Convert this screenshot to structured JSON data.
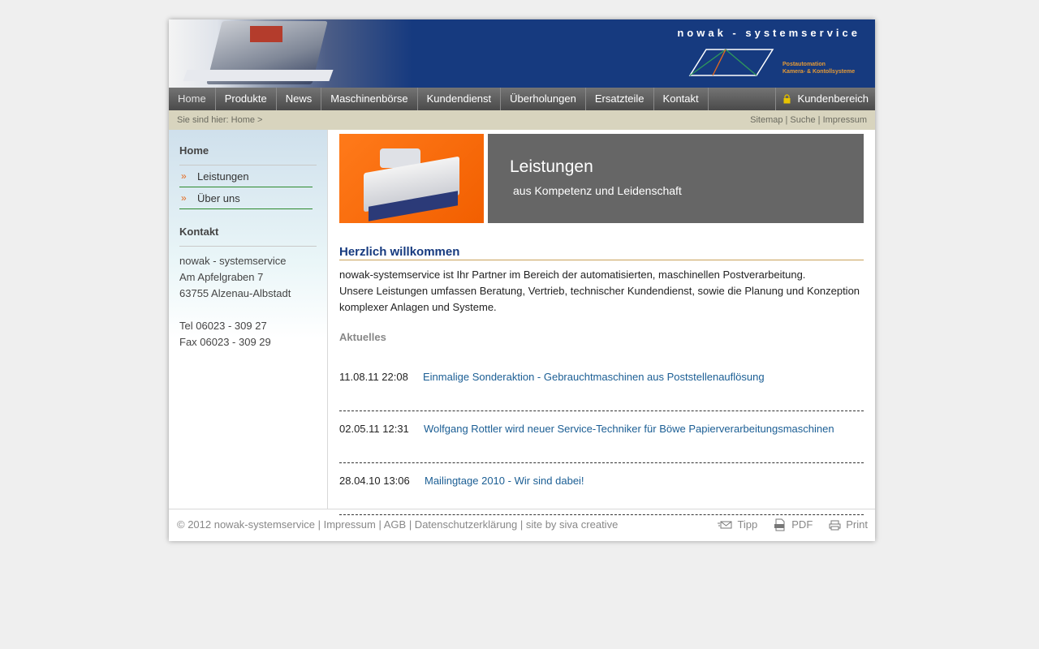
{
  "header": {
    "brand": "nowak - systemservice",
    "tagline_1": "Postautomation",
    "tagline_2": "Kamera- & Kontollsysteme"
  },
  "nav": {
    "items": [
      "Home",
      "Produkte",
      "News",
      "Maschinenbörse",
      "Kundendienst",
      "Überholungen",
      "Ersatzteile",
      "Kontakt"
    ],
    "active": "Home",
    "login_label": "Kundenbereich"
  },
  "breadcrumb": {
    "text": "Sie sind hier: Home >",
    "links": "Sitemap | Suche | Impressum"
  },
  "sidebar": {
    "section1_title": "Home",
    "items": [
      "Leistungen",
      "Über uns"
    ],
    "section2_title": "Kontakt",
    "address": {
      "company": "nowak - systemservice",
      "street": "Am Apfelgraben 7",
      "city": "63755 Alzenau-Albstadt",
      "tel": "Tel  06023 - 309 27",
      "fax": "Fax 06023 - 309 29"
    }
  },
  "banner": {
    "title": "Leistungen",
    "subtitle": "aus Kompetenz und Leidenschaft"
  },
  "main": {
    "heading": "Herzlich willkommen",
    "intro_1": "nowak-systemservice ist Ihr Partner im Bereich der automatisierten, maschinellen Postverarbeitung.",
    "intro_2": "Unsere Leistungen umfassen Beratung, Vertrieb, technischer Kundendienst, sowie die Planung und Konzeption komplexer Anlagen und Systeme.",
    "news_title": "Aktuelles",
    "news": [
      {
        "date": "11.08.11 22:08",
        "title": "Einmalige Sonderaktion - Gebrauchtmaschinen aus Poststellenauflösung"
      },
      {
        "date": "02.05.11 12:31",
        "title": "Wolfgang Rottler wird neuer Service-Techniker für Böwe Papierverarbeitungsmaschinen"
      },
      {
        "date": "28.04.10 13:06",
        "title": "Mailingtage 2010 - Wir sind dabei!"
      }
    ]
  },
  "footer": {
    "copyright": "© 2012 nowak-systemservice | Impressum | AGB | Datenschutzerklärung | site by siva creative",
    "tipp": "Tipp",
    "pdf": "PDF",
    "print": "Print"
  },
  "colors": {
    "header_blue": "#163a7f",
    "accent_orange": "#e4691e",
    "link_blue": "#1b5e94"
  }
}
